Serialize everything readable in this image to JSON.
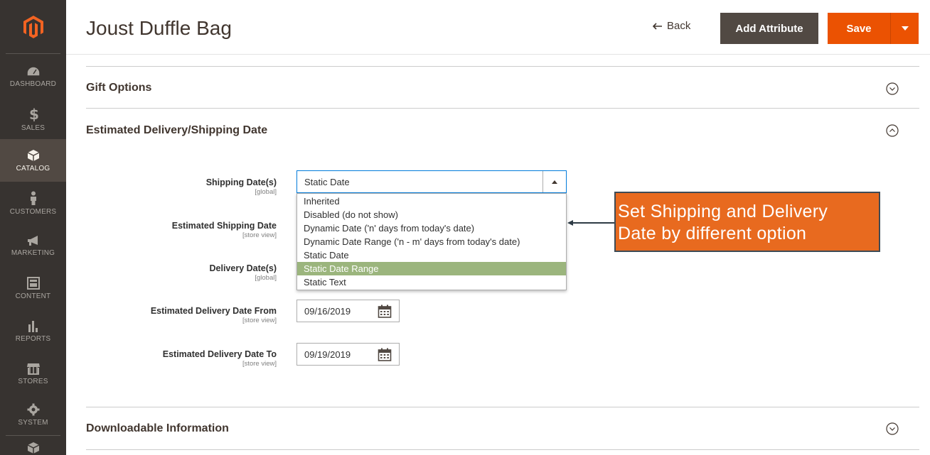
{
  "sidebar": {
    "items": [
      {
        "label": "DASHBOARD",
        "icon": "dashboard-icon"
      },
      {
        "label": "SALES",
        "icon": "dollar-icon"
      },
      {
        "label": "CATALOG",
        "icon": "box-icon"
      },
      {
        "label": "CUSTOMERS",
        "icon": "person-icon"
      },
      {
        "label": "MARKETING",
        "icon": "megaphone-icon"
      },
      {
        "label": "CONTENT",
        "icon": "content-icon"
      },
      {
        "label": "REPORTS",
        "icon": "bar-chart-icon"
      },
      {
        "label": "STORES",
        "icon": "storefront-icon"
      },
      {
        "label": "SYSTEM",
        "icon": "gear-icon"
      }
    ],
    "active": "CATALOG"
  },
  "header": {
    "title": "Joust Duffle Bag",
    "back_label": "Back",
    "add_attribute_label": "Add Attribute",
    "save_label": "Save"
  },
  "sections": {
    "gift_options": "Gift Options",
    "estimated_delivery": "Estimated Delivery/Shipping Date",
    "downloadable": "Downloadable Information"
  },
  "fields": {
    "shipping_dates": {
      "label": "Shipping Date(s)",
      "scope": "[global]",
      "value": "Static Date"
    },
    "estimated_shipping_date": {
      "label": "Estimated Shipping Date",
      "scope": "[store view]"
    },
    "delivery_dates": {
      "label": "Delivery Date(s)",
      "scope": "[global]"
    },
    "delivery_from": {
      "label": "Estimated Delivery Date From",
      "scope": "[store view]",
      "value": "09/16/2019"
    },
    "delivery_to": {
      "label": "Estimated Delivery Date To",
      "scope": "[store view]",
      "value": "09/19/2019"
    }
  },
  "dropdown": {
    "options": [
      "Inherited",
      "Disabled (do not show)",
      "Dynamic Date ('n' days from today's date)",
      "Dynamic Date Range ('n - m' days from today's date)",
      "Static Date",
      "Static Date Range",
      "Static Text"
    ],
    "highlighted": "Static Date Range"
  },
  "callout": {
    "line1": "Set Shipping and Delivery",
    "line2": "Date by different option"
  },
  "colors": {
    "sidebar": "#373330",
    "accent": "#eb5202",
    "secondary_button": "#514943",
    "highlight": "#9bb57d",
    "callout": "#e86a1f"
  }
}
